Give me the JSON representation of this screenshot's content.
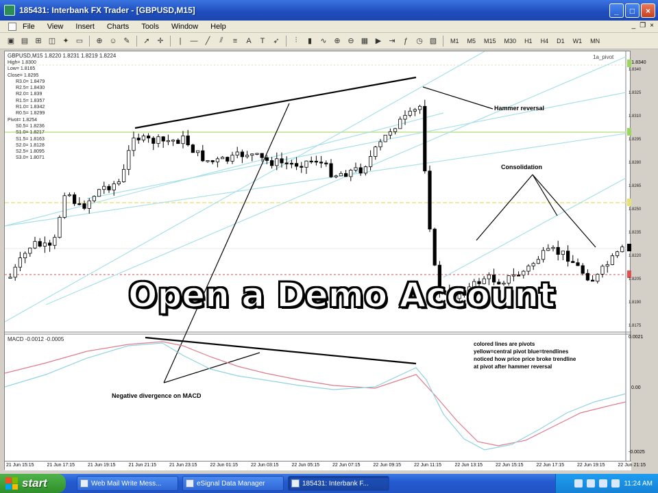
{
  "window": {
    "title": "185431: Interbank FX Trader - [GBPUSD,M15]"
  },
  "menu": {
    "items": [
      "File",
      "View",
      "Insert",
      "Charts",
      "Tools",
      "Window",
      "Help"
    ]
  },
  "toolbar": {
    "timeframes": [
      "M1",
      "M5",
      "M15",
      "M30",
      "H1",
      "H4",
      "D1",
      "W1",
      "MN"
    ]
  },
  "chart": {
    "header": "GBPUSD,M15  1.8220 1.8231 1.8219 1.8224",
    "indicator_tag": "1a_pivot",
    "pivot_labels": [
      "High= 1.8300",
      "Low= 1.8165",
      "Close= 1.8295",
      "R3.0= 1.8479",
      "R2.5= 1.8430",
      "R2.0= 1.839",
      "R1.5= 1.8357",
      "R1.0= 1.8342",
      "R0.5= 1.8299",
      "Pivot= 1.8254",
      "S0.5= 1.8236",
      "S1.0= 1.8217",
      "S1.5= 1.8163",
      "S2.0= 1.8128",
      "S2.5= 1.8095",
      "S3.0= 1.8071"
    ],
    "price_axis": [
      "1.8340",
      "1.8325",
      "1.8310",
      "1.8295",
      "1.8280",
      "1.8265",
      "1.8250",
      "1.8235",
      "1.8220",
      "1.8205",
      "1.8190",
      "1.8175"
    ],
    "price_badges": {
      "top": "1.8340",
      "green": "1.8295",
      "yellow": "1.8250",
      "current": "1.8224",
      "red": "1.8207"
    },
    "annotations": {
      "hammer": "Hammer reversal",
      "consolidation": "Consolidation",
      "negative_divergence": "Negative divergence on MACD",
      "notes": [
        "colored lines are pivots",
        "yellow=central pivot blue=trendlines",
        "noticed how price price broke trendline",
        "at pivot after hammer reversal"
      ]
    },
    "macd": {
      "header": "MACD -0.0012 -0.0005",
      "axis": [
        "0.0021",
        "0.00",
        "-0.0025"
      ]
    },
    "time_axis": [
      "21 Jun 15:15",
      "21 Jun 17:15",
      "21 Jun 19:15",
      "21 Jun 21:15",
      "21 Jun 23:15",
      "22 Jun 01:15",
      "22 Jun 03:15",
      "22 Jun 05:15",
      "22 Jun 07:15",
      "22 Jun 09:15",
      "22 Jun 11:15",
      "22 Jun 13:15",
      "22 Jun 15:15",
      "22 Jun 17:15",
      "22 Jun 19:15",
      "22 Jun 21:15"
    ],
    "banner": "Open a Demo Account"
  },
  "taskbar": {
    "start": "start",
    "tasks": [
      "Web Mail Write Mess...",
      "eSignal Data Manager",
      "185431: Interbank F..."
    ],
    "clock": "11:24 AM"
  },
  "colors": {
    "candle": "#000000",
    "pivot_yellow": "#e8e070",
    "pivot_green": "#9ad65a",
    "trendline_cyan": "#7fd6e8",
    "macd_main": "#e07a8a",
    "macd_signal": "#8fd3e3"
  }
}
